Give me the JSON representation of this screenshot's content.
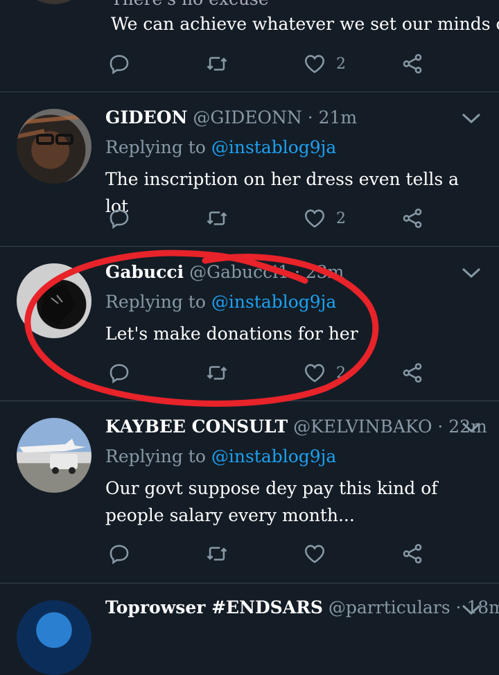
{
  "tweets": [
    {
      "text_line1": "There's no excuse",
      "text_line2": "We can achieve whatever we set our minds on",
      "likes": "2"
    },
    {
      "name": "GIDEON",
      "meta": "@GIDEONN · 21m",
      "reply_prefix": "Replying to",
      "reply_handle": "@instablog9ja",
      "text": "The inscription on her dress even tells a lot",
      "likes": "2"
    },
    {
      "name": "Gabucci",
      "meta": "@Gabucci1 · 23m",
      "reply_prefix": "Replying to",
      "reply_handle": "@instablog9ja",
      "text": "Let's make donations for her",
      "likes": "2"
    },
    {
      "name": "KAYBEE CONSULT",
      "meta": "@KELVINBAKO · 22m",
      "reply_prefix": "Replying to",
      "reply_handle": "@instablog9ja",
      "text": "Our govt suppose dey pay this kind of people salary every month...",
      "likes": ""
    },
    {
      "name": "Toprowser #ENDSARS",
      "meta": "@parrticulars · 18m"
    }
  ],
  "colors": {
    "background": "#141d26",
    "divider": "#38444d",
    "secondary_text": "#8899a6",
    "link": "#1da1f2",
    "annotation": "#e8232a"
  },
  "icons": [
    "reply-icon",
    "retweet-icon",
    "like-icon",
    "share-icon",
    "chevron-down-icon"
  ]
}
